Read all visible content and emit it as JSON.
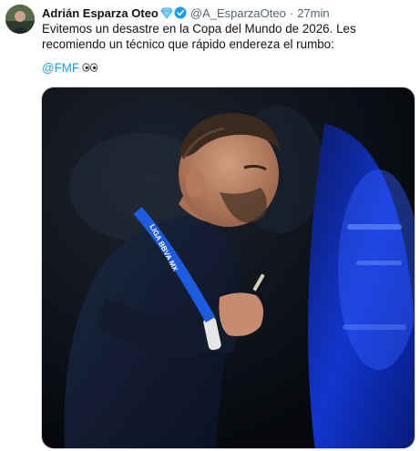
{
  "tweet": {
    "author_name": "Adrián Esparza Oteo",
    "handle": "@A_EsparzaOteo",
    "separator": "·",
    "time": "27min",
    "text": "Evitemos un desastre en la Copa del Mundo de 2026. Les recomiendo un técnico que rápido endereza el rumbo:",
    "mention": "@FMF",
    "emoji": "👀",
    "lanyard_text": "LIGA BBVA MX"
  },
  "colors": {
    "link": "#1d9bf0",
    "verified_blue": "#1d9bf0",
    "verified_gem": "#7fd3ff",
    "secondary_text": "#536471"
  }
}
